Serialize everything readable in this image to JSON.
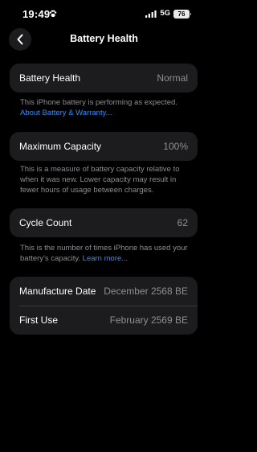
{
  "status_bar": {
    "time": "19:49",
    "network": "5G",
    "battery_level": "76"
  },
  "nav": {
    "title": "Battery Health"
  },
  "battery_health": {
    "label": "Battery Health",
    "value": "Normal",
    "footer_text": "This iPhone battery is performing as expected.",
    "footer_link": "About Battery & Warranty..."
  },
  "maximum_capacity": {
    "label": "Maximum Capacity",
    "value": "100%",
    "footer_text": "This is a measure of battery capacity relative to when it was new. Lower capacity may result in fewer hours of usage between charges."
  },
  "cycle_count": {
    "label": "Cycle Count",
    "value": "62",
    "footer_text": "This is the number of times iPhone has used your battery's capacity.",
    "footer_link": "Learn more..."
  },
  "dates": {
    "manufacture_label": "Manufacture Date",
    "manufacture_value": "December 2568 BE",
    "first_use_label": "First Use",
    "first_use_value": "February 2569 BE"
  },
  "colors": {
    "background": "#000000",
    "card": "#1c1c1e",
    "secondary_text": "#8e8e93",
    "link": "#3a8bf7"
  }
}
